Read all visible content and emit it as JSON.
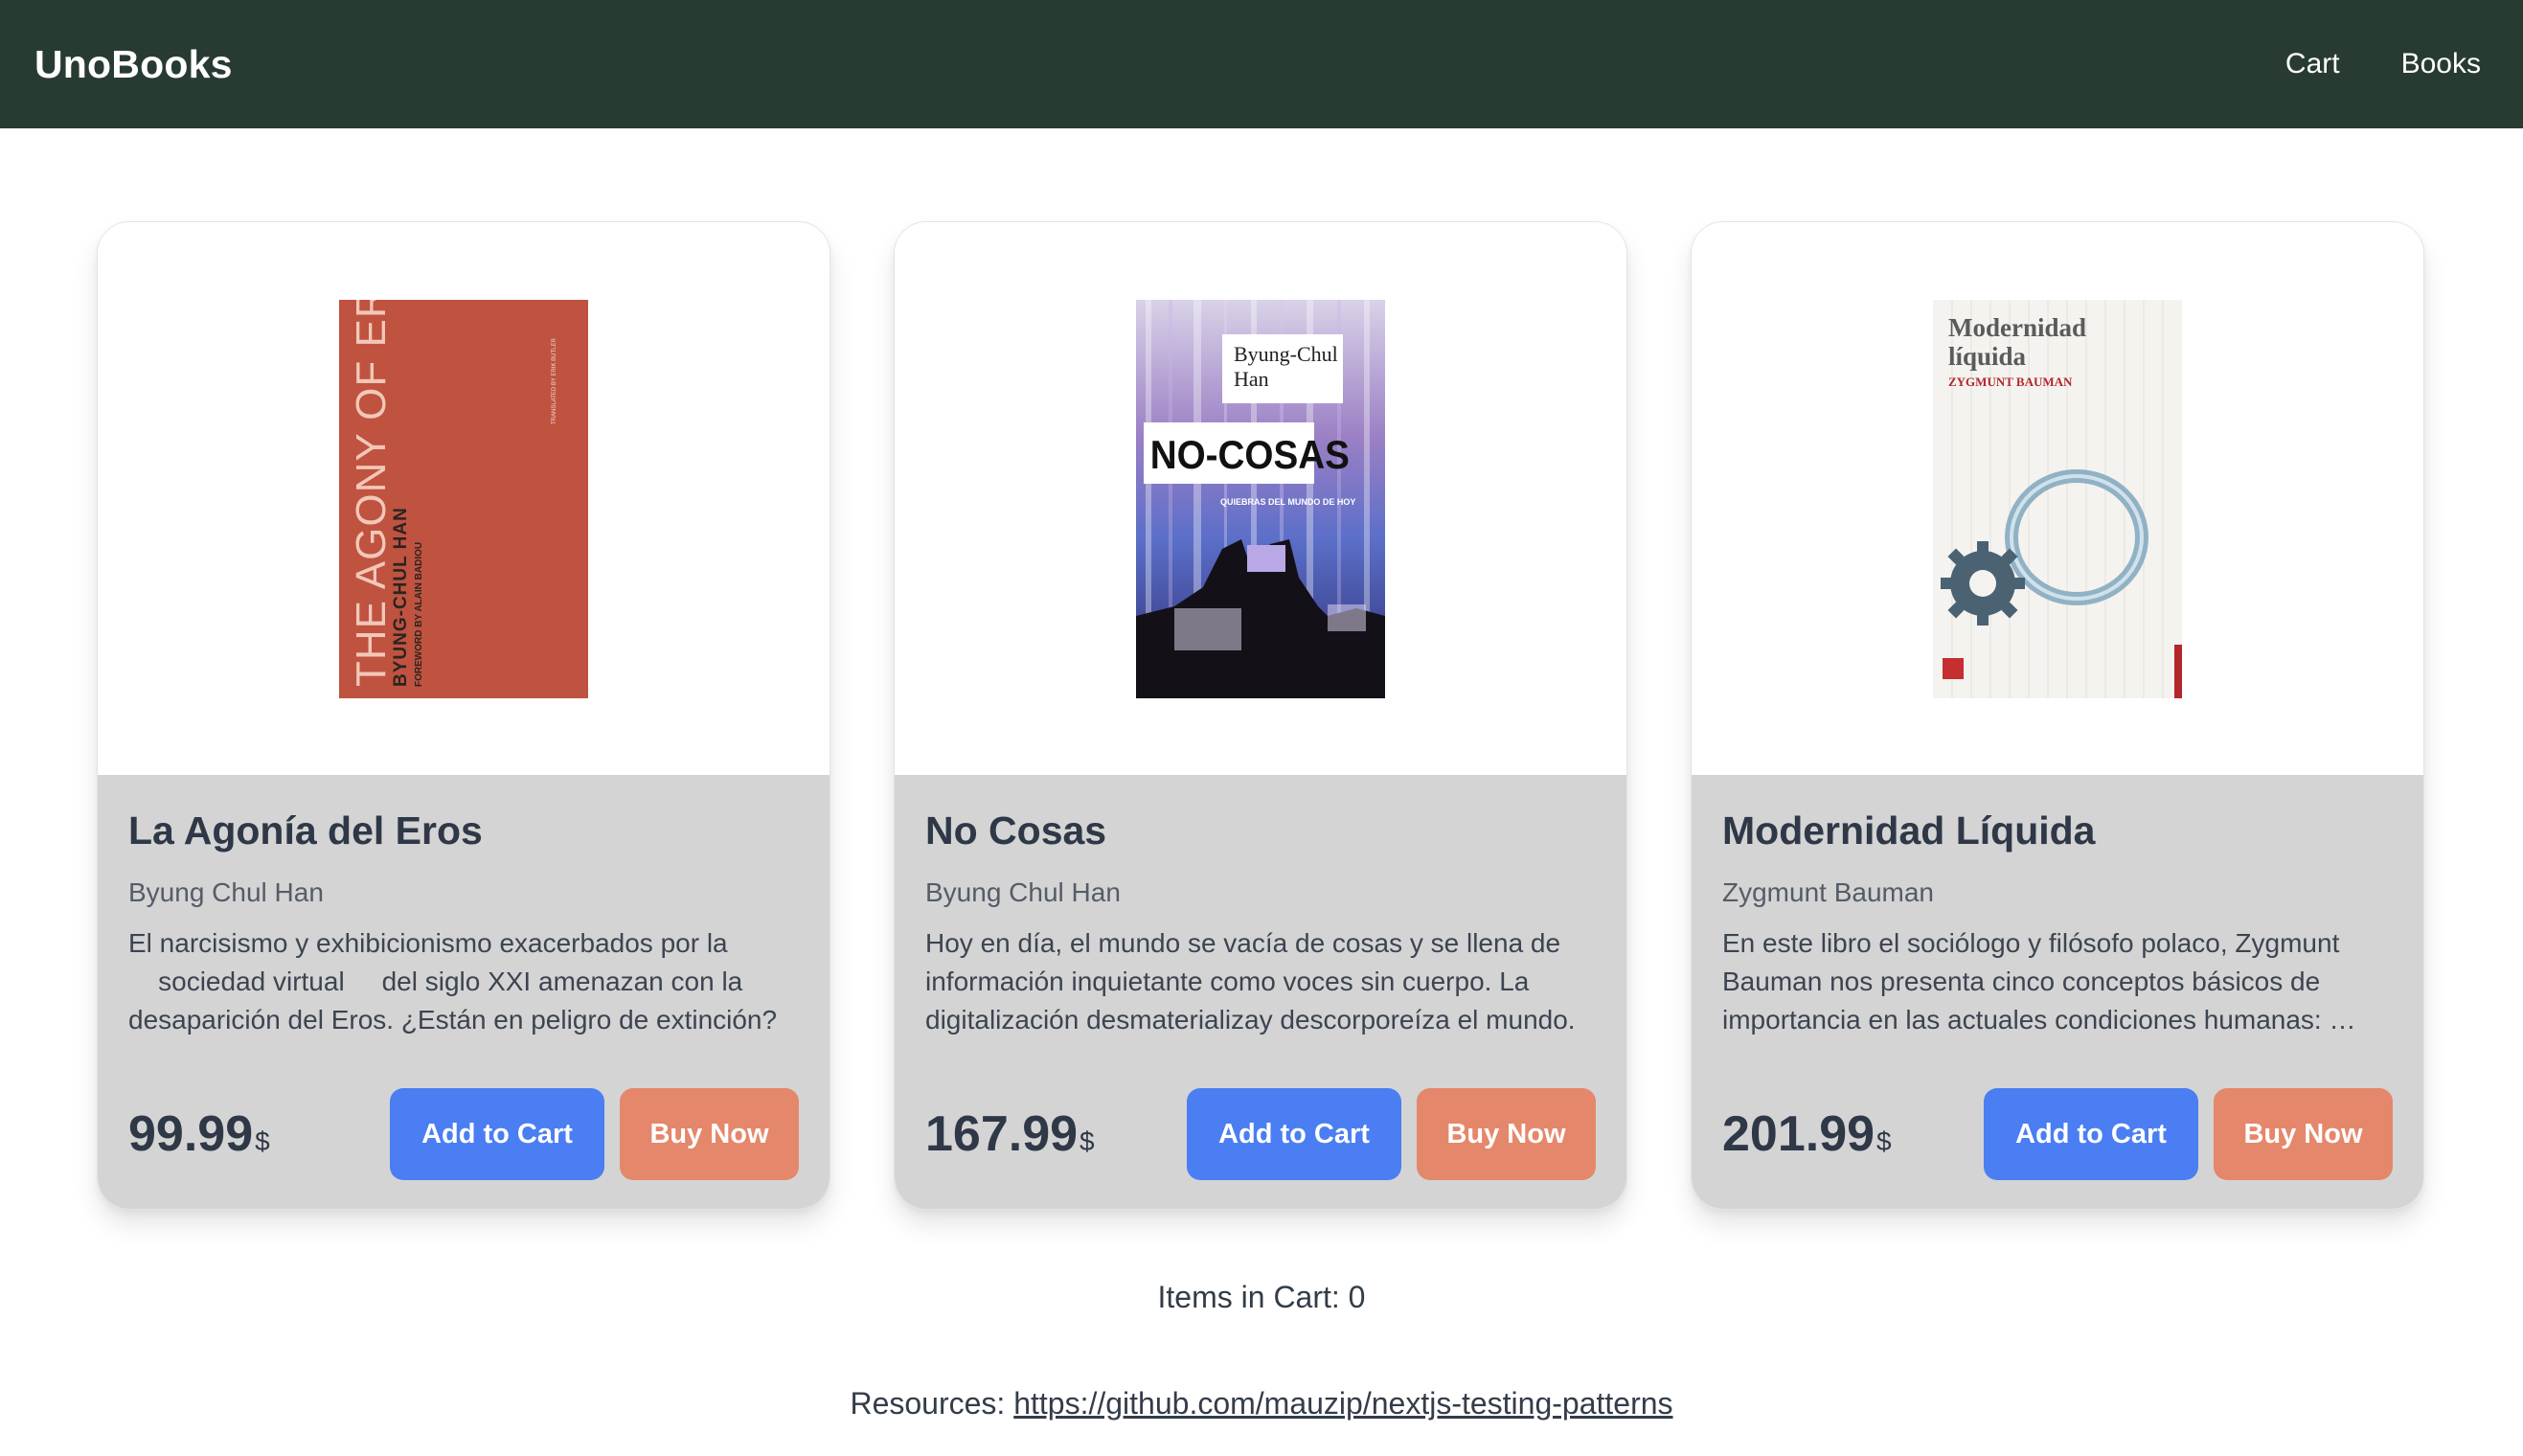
{
  "header": {
    "brand": "UnoBooks",
    "nav": [
      {
        "label": "Cart"
      },
      {
        "label": "Books"
      }
    ]
  },
  "books": [
    {
      "title": "La Agonía del Eros",
      "author": "Byung Chul Han",
      "description": "El narcisismo y exhibicionismo exacerbados por la\n    sociedad virtual     del siglo XXI amenazan con la desaparición del Eros. ¿Están en peligro de extinción?",
      "price": "99.99",
      "currency": "$",
      "add_to_cart": "Add to Cart",
      "buy_now": "Buy Now",
      "cover": {
        "background": "#bf5340",
        "lines": [
          "THE AGONY OF EROS",
          "BYUNG-CHUL HAN",
          "FOREWORD BY ALAIN BADIOU",
          "TRANSLATED BY ERIK BUTLER"
        ]
      }
    },
    {
      "title": "No Cosas",
      "author": "Byung Chul Han",
      "description": "Hoy en día, el mundo se vacía de cosas y se llena de información inquietante como voces sin cuerpo. La digitalización desmaterializay descorporeíza el mundo.",
      "price": "167.99",
      "currency": "$",
      "add_to_cart": "Add to Cart",
      "buy_now": "Buy Now",
      "cover": {
        "lines": [
          "Byung-Chul Han",
          "NO-COSAS",
          "QUIEBRAS DEL MUNDO DE HOY"
        ]
      }
    },
    {
      "title": "Modernidad Líquida",
      "author": "Zygmunt Bauman",
      "description": "En este libro el sociólogo y filósofo polaco, Zygmunt Bauman nos presenta cinco conceptos básicos de importancia en las actuales condiciones humanas: emancipación, individualidad.",
      "price": "201.99",
      "currency": "$",
      "add_to_cart": "Add to Cart",
      "buy_now": "Buy Now",
      "cover": {
        "lines": [
          "Modernidad líquida",
          "ZYGMUNT BAUMAN"
        ]
      }
    }
  ],
  "cart": {
    "label": "Items in Cart: 0"
  },
  "footer": {
    "resources_label": "Resources:",
    "resources_link": "https://github.com/mauzip/nextjs-testing-patterns"
  },
  "colors": {
    "navbar": "#283b32",
    "add_to_cart": "#4a7ef2",
    "buy_now": "#e5876b",
    "card_body": "#d4d4d5"
  }
}
